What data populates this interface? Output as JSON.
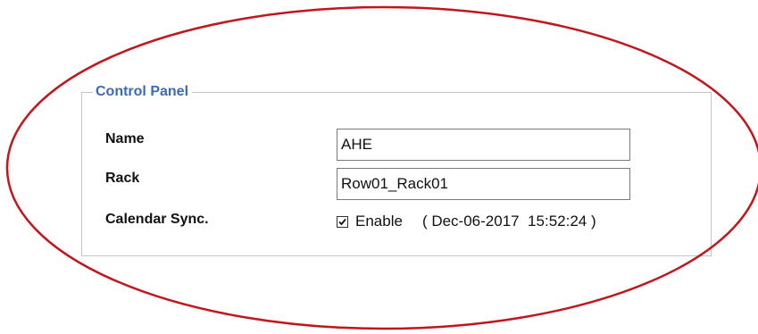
{
  "panel": {
    "title": "Control Panel"
  },
  "fields": {
    "name": {
      "label": "Name",
      "value": "AHE"
    },
    "rack": {
      "label": "Rack",
      "value": "Row01_Rack01"
    }
  },
  "calendar_sync": {
    "label": "Calendar Sync.",
    "checked": true,
    "checkbox_label": "Enable",
    "timestamp_open": "( ",
    "timestamp": "Dec-06-2017  15:52:24",
    "timestamp_close": " )"
  },
  "colors": {
    "legend": "#3a6bb0",
    "annotation_ellipse": "#c0161c"
  },
  "icons": {
    "checkbox_mark": "checkmark-icon"
  }
}
